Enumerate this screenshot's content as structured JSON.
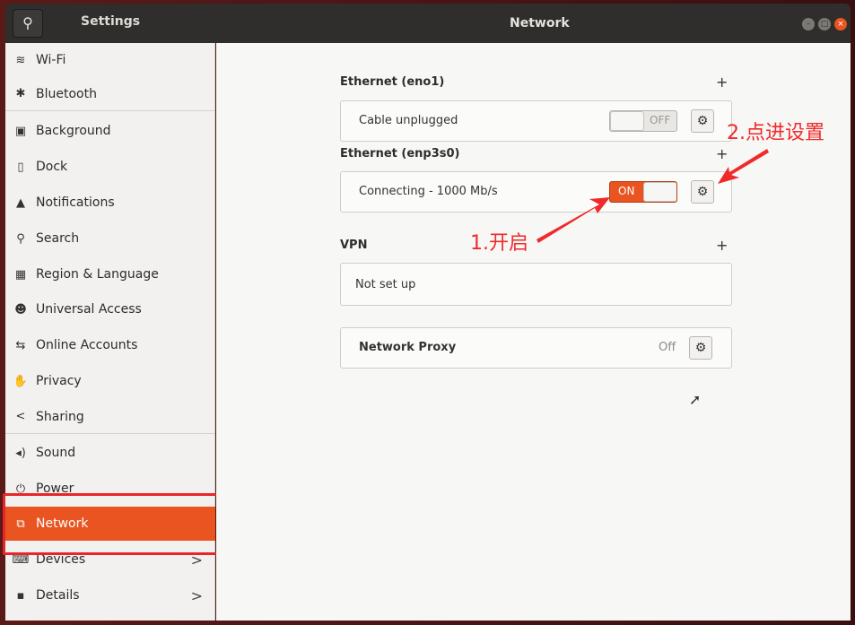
{
  "app_title": "Settings",
  "panel_title": "Network",
  "sidebar": {
    "items": [
      {
        "label": "Wi-Fi",
        "icon": "wifi-icon",
        "glyph": "≋"
      },
      {
        "label": "Bluetooth",
        "icon": "bluetooth-icon",
        "glyph": "✱"
      },
      {
        "label": "Background",
        "icon": "background-icon",
        "glyph": "▣"
      },
      {
        "label": "Dock",
        "icon": "dock-icon",
        "glyph": "▯"
      },
      {
        "label": "Notifications",
        "icon": "bell-icon",
        "glyph": "▲"
      },
      {
        "label": "Search",
        "icon": "search-icon",
        "glyph": "⚲"
      },
      {
        "label": "Region & Language",
        "icon": "region-icon",
        "glyph": "▦"
      },
      {
        "label": "Universal Access",
        "icon": "accessibility-icon",
        "glyph": "☻"
      },
      {
        "label": "Online Accounts",
        "icon": "online-accounts-icon",
        "glyph": "⇆"
      },
      {
        "label": "Privacy",
        "icon": "privacy-hand-icon",
        "glyph": "✋"
      },
      {
        "label": "Sharing",
        "icon": "share-icon",
        "glyph": "<"
      },
      {
        "label": "Sound",
        "icon": "speaker-icon",
        "glyph": "◂)"
      },
      {
        "label": "Power",
        "icon": "power-icon",
        "glyph": "⏻"
      },
      {
        "label": "Network",
        "icon": "network-icon",
        "glyph": "⧉"
      },
      {
        "label": "Devices",
        "icon": "devices-icon",
        "glyph": "⌨"
      },
      {
        "label": "Details",
        "icon": "details-icon",
        "glyph": "▪"
      }
    ]
  },
  "chevron": ">",
  "eth1": {
    "title": "Ethernet (eno1)",
    "status": "Cable unplugged",
    "toggle": "OFF",
    "toggle_on": false
  },
  "eth2": {
    "title": "Ethernet (enp3s0)",
    "status": "Connecting - 1000 Mb/s",
    "toggle": "ON",
    "toggle_on": true
  },
  "vpn": {
    "title": "VPN",
    "status": "Not set up"
  },
  "proxy": {
    "title": "Network Proxy",
    "status": "Off"
  },
  "plus": "+",
  "gear": "⚙",
  "annotations": {
    "step1": "1.开启",
    "step2": "2.点进设置"
  },
  "colors": {
    "accent": "#e95420",
    "annotation": "#f02a2a"
  }
}
